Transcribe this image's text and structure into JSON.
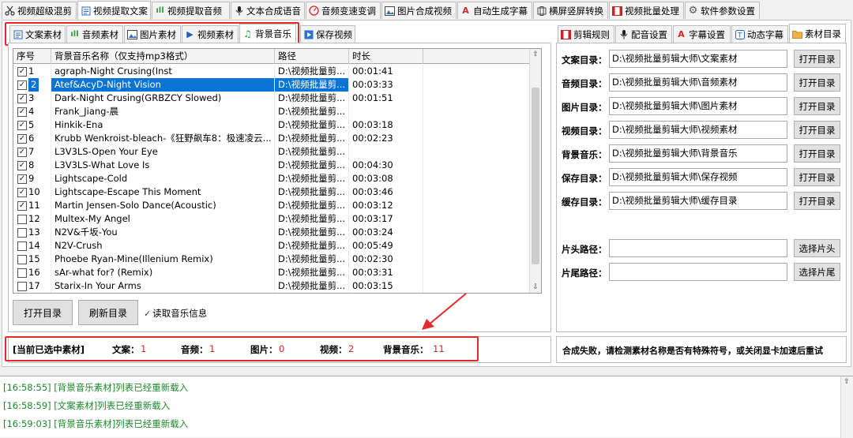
{
  "top_tabs": [
    {
      "label": "视频超级混剪",
      "icon": "scissors-icon"
    },
    {
      "label": "视频提取文案",
      "icon": "document-icon"
    },
    {
      "label": "视频提取音频",
      "icon": "audio-wave-icon"
    },
    {
      "label": "文本合成语音",
      "icon": "microphone-icon"
    },
    {
      "label": "音频变速变调",
      "icon": "speedometer-icon"
    },
    {
      "label": "图片合成视频",
      "icon": "image-icon"
    },
    {
      "label": "自动生成字幕",
      "icon": "subtitle-icon"
    },
    {
      "label": "横屏竖屏转换",
      "icon": "rotate-screen-icon"
    },
    {
      "label": "视频批量处理",
      "icon": "film-icon"
    },
    {
      "label": "软件参数设置",
      "icon": "gear-icon"
    }
  ],
  "inner_tabs": [
    {
      "label": "文案素材",
      "icon": "document-icon"
    },
    {
      "label": "音频素材",
      "icon": "audio-wave-icon"
    },
    {
      "label": "图片素材",
      "icon": "image-icon"
    },
    {
      "label": "视频素材",
      "icon": "play-icon"
    },
    {
      "label": "背景音乐",
      "icon": "music-note-icon"
    },
    {
      "label": "保存视频",
      "icon": "save-video-icon"
    }
  ],
  "table": {
    "columns": [
      "序号",
      "背景音乐名称（仅支持mp3格式）",
      "路径",
      "时长"
    ],
    "rows": [
      {
        "checked": true,
        "index": "1",
        "name": "agraph-Night Crusing(Inst",
        "path": "D:\\视频批量剪...",
        "duration": "00:01:41"
      },
      {
        "checked": true,
        "index": "2",
        "name": "Atef&AcyD-Night Vision",
        "path": "D:\\视频批量剪...",
        "duration": "00:03:33",
        "selected": true
      },
      {
        "checked": true,
        "index": "3",
        "name": "Dark-Night Crusing(GRBZCY Slowed)",
        "path": "D:\\视频批量剪...",
        "duration": "00:01:51"
      },
      {
        "checked": true,
        "index": "4",
        "name": "Frank_Jiang-晨",
        "path": "D:\\视频批量剪...",
        "duration": ""
      },
      {
        "checked": true,
        "index": "5",
        "name": "Hinkik-Ena",
        "path": "D:\\视频批量剪...",
        "duration": "00:03:18"
      },
      {
        "checked": true,
        "index": "6",
        "name": "Krubb Wenkroist-bleach-《狂野飙车8：极速凌云...",
        "path": "D:\\视频批量剪...",
        "duration": "00:02:23"
      },
      {
        "checked": true,
        "index": "7",
        "name": "L3V3LS-Open Your Eye",
        "path": "D:\\视频批量剪...",
        "duration": ""
      },
      {
        "checked": true,
        "index": "8",
        "name": "L3V3LS-What Love Is",
        "path": "D:\\视频批量剪...",
        "duration": "00:04:30"
      },
      {
        "checked": true,
        "index": "9",
        "name": "Lightscape-Cold",
        "path": "D:\\视频批量剪...",
        "duration": "00:03:08"
      },
      {
        "checked": true,
        "index": "10",
        "name": "Lightscape-Escape This Moment",
        "path": "D:\\视频批量剪...",
        "duration": "00:03:46"
      },
      {
        "checked": true,
        "index": "11",
        "name": "Martin Jensen-Solo Dance(Acoustic)",
        "path": "D:\\视频批量剪...",
        "duration": "00:03:12"
      },
      {
        "checked": false,
        "index": "12",
        "name": "Multex-My Angel",
        "path": "D:\\视频批量剪...",
        "duration": "00:03:17"
      },
      {
        "checked": false,
        "index": "13",
        "name": "N2V&千坂-You",
        "path": "D:\\视频批量剪...",
        "duration": "00:03:24"
      },
      {
        "checked": false,
        "index": "14",
        "name": "N2V-Crush",
        "path": "D:\\视频批量剪...",
        "duration": "00:05:49"
      },
      {
        "checked": false,
        "index": "15",
        "name": "Phoebe Ryan-Mine(Illenium Remix)",
        "path": "D:\\视频批量剪...",
        "duration": "00:02:30"
      },
      {
        "checked": false,
        "index": "16",
        "name": "sAr-what for? (Remix)",
        "path": "D:\\视频批量剪...",
        "duration": "00:03:31"
      },
      {
        "checked": false,
        "index": "17",
        "name": "Starix-In Your Arms",
        "path": "D:\\视频批量剪...",
        "duration": "00:03:15"
      }
    ]
  },
  "left_buttons": {
    "open_dir": "打开目录",
    "refresh_dir": "刷新目录",
    "read_info": "读取音乐信息"
  },
  "right_tabs": [
    {
      "label": "剪辑规则",
      "icon": "film-icon"
    },
    {
      "label": "配音设置",
      "icon": "microphone-icon"
    },
    {
      "label": "字幕设置",
      "icon": "subtitle-icon"
    },
    {
      "label": "动态字幕",
      "icon": "text-box-icon"
    },
    {
      "label": "素材目录",
      "icon": "folder-icon"
    }
  ],
  "directories": [
    {
      "label": "文案目录：",
      "value": "D:\\视频批量剪辑大师\\文案素材",
      "button": "打开目录"
    },
    {
      "label": "音频目录：",
      "value": "D:\\视频批量剪辑大师\\音频素材",
      "button": "打开目录"
    },
    {
      "label": "图片目录：",
      "value": "D:\\视频批量剪辑大师\\图片素材",
      "button": "打开目录"
    },
    {
      "label": "视频目录：",
      "value": "D:\\视频批量剪辑大师\\视频素材",
      "button": "打开目录"
    },
    {
      "label": "背景音乐：",
      "value": "D:\\视频批量剪辑大师\\背景音乐",
      "button": "打开目录"
    },
    {
      "label": "保存目录：",
      "value": "D:\\视频批量剪辑大师\\保存视频",
      "button": "打开目录"
    },
    {
      "label": "缓存目录：",
      "value": "D:\\视频批量剪辑大师\\缓存目录",
      "button": "打开目录"
    }
  ],
  "clips": [
    {
      "label": "片头路径：",
      "value": "",
      "button": "选择片头"
    },
    {
      "label": "片尾路径：",
      "value": "",
      "button": "选择片尾"
    }
  ],
  "status": {
    "title": "[当前已选中素材]",
    "items": [
      {
        "label": "文案：",
        "value": "1"
      },
      {
        "label": "音频：",
        "value": "1"
      },
      {
        "label": "图片：",
        "value": "0"
      },
      {
        "label": "视频：",
        "value": "2"
      },
      {
        "label": "背景音乐：",
        "value": "11"
      }
    ],
    "message": "合成失败，请检测素材名称是否有特殊符号，或关闭显卡加速后重试"
  },
  "log": [
    "[16:58:55] [背景音乐素材]列表已经重新载入",
    "[16:58:59] [文案素材]列表已经重新载入",
    "[16:59:03] [背景音乐素材]列表已经重新载入"
  ],
  "colors": {
    "highlight": "#e22b2b",
    "selection": "#0a73d6",
    "log_text": "#1d8a2a",
    "status_value": "#c62828"
  }
}
